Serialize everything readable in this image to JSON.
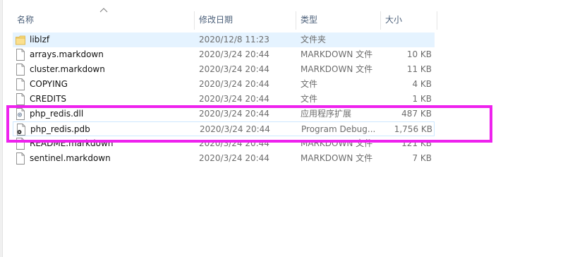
{
  "columns": {
    "name": "名称",
    "date": "修改日期",
    "type": "类型",
    "size": "大小"
  },
  "files": [
    {
      "name": "liblzf",
      "date": "2020/12/8 11:23",
      "type": "文件夹",
      "size": "",
      "icon": "folder-icon",
      "state": "selected"
    },
    {
      "name": "arrays.markdown",
      "date": "2020/3/24 20:44",
      "type": "MARKDOWN 文件",
      "size": "10 KB",
      "icon": "document-icon",
      "state": ""
    },
    {
      "name": "cluster.markdown",
      "date": "2020/3/24 20:44",
      "type": "MARKDOWN 文件",
      "size": "11 KB",
      "icon": "document-icon",
      "state": ""
    },
    {
      "name": "COPYING",
      "date": "2020/3/24 20:44",
      "type": "文件",
      "size": "4 KB",
      "icon": "document-icon",
      "state": ""
    },
    {
      "name": "CREDITS",
      "date": "2020/3/24 20:44",
      "type": "文件",
      "size": "1 KB",
      "icon": "document-icon",
      "state": ""
    },
    {
      "name": "php_redis.dll",
      "date": "2020/3/24 20:44",
      "type": "应用程序扩展",
      "size": "487 KB",
      "icon": "dll-icon",
      "state": ""
    },
    {
      "name": "php_redis.pdb",
      "date": "2020/3/24 20:44",
      "type": "Program Debug...",
      "size": "1,756 KB",
      "icon": "pdb-icon",
      "state": "outlined"
    },
    {
      "name": "README.markdown",
      "date": "2020/3/24 20:44",
      "type": "MARKDOWN 文件",
      "size": "121 KB",
      "icon": "document-icon",
      "state": ""
    },
    {
      "name": "sentinel.markdown",
      "date": "2020/3/24 20:44",
      "type": "MARKDOWN 文件",
      "size": "7 KB",
      "icon": "document-icon",
      "state": ""
    }
  ],
  "colors": {
    "selection": "#e5f3ff",
    "annotation": "#ee22ee",
    "header_text": "#4c607a"
  }
}
